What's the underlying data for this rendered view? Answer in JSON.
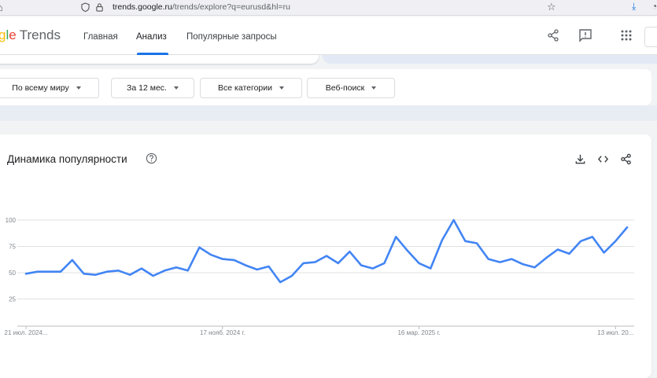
{
  "browser": {
    "url_domain": "trends.google.ru",
    "url_rest": "/trends/explore?q=eurusd&hl=ru"
  },
  "header": {
    "logo_g1": "g",
    "logo_g2": "l",
    "logo_g3": "e",
    "logo_trends": "Trends",
    "nav": [
      "Главная",
      "Анализ",
      "Популярные запросы"
    ],
    "active_nav": "Анализ"
  },
  "filters": [
    {
      "label": "По всему миру"
    },
    {
      "label": "За 12 мес."
    },
    {
      "label": "Все категории"
    },
    {
      "label": "Веб-поиск"
    }
  ],
  "card": {
    "title": "Динамика популярности"
  },
  "colors": {
    "accent": "#1a73e8",
    "line": "#4285f4"
  },
  "chart_data": {
    "type": "line",
    "title": "Динамика популярности",
    "ylim": [
      0,
      100
    ],
    "yticks": [
      25,
      50,
      75,
      100
    ],
    "xticks": [
      "21 июл. 2024...",
      "17 нояб. 2024 г.",
      "16 мар. 2025 г.",
      "13 июл. 20..."
    ],
    "xtick_index": [
      0,
      17,
      34,
      51
    ],
    "grid": true,
    "series": [
      {
        "values": [
          49,
          51,
          51,
          51,
          62,
          49,
          48,
          51,
          52,
          48,
          54,
          47,
          52,
          55,
          52,
          74,
          67,
          63,
          62,
          57,
          53,
          56,
          41,
          47,
          59,
          60,
          66,
          59,
          70,
          57,
          54,
          59,
          84,
          71,
          59,
          54,
          81,
          100,
          80,
          78,
          63,
          60,
          63,
          58,
          55,
          64,
          72,
          68,
          80,
          84,
          69,
          80,
          93
        ]
      }
    ]
  }
}
